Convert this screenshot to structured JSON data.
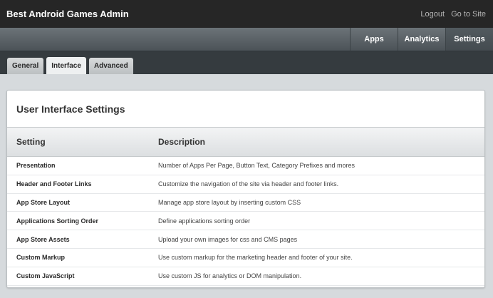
{
  "header": {
    "title": "Best Android Games Admin",
    "links": [
      "Logout",
      "Go to Site"
    ]
  },
  "nav": {
    "items": [
      {
        "label": "Apps",
        "active": false
      },
      {
        "label": "Analytics",
        "active": false
      },
      {
        "label": "Settings",
        "active": true
      }
    ]
  },
  "tabs": [
    {
      "label": "General",
      "active": false
    },
    {
      "label": "Interface",
      "active": true
    },
    {
      "label": "Advanced",
      "active": false
    }
  ],
  "panel": {
    "title": "User Interface Settings",
    "columns": [
      "Setting",
      "Description"
    ],
    "rows": [
      {
        "setting": "Presentation",
        "description": "Number of Apps Per Page, Button Text, Category Prefixes and mores"
      },
      {
        "setting": "Header and Footer Links",
        "description": "Customize the navigation of the site via header and footer links."
      },
      {
        "setting": "App Store Layout",
        "description": "Manage app store layout by inserting custom CSS"
      },
      {
        "setting": "Applications Sorting Order",
        "description": "Define applications sorting order"
      },
      {
        "setting": "App Store Assets",
        "description": "Upload your own images for css and CMS pages"
      },
      {
        "setting": "Custom Markup",
        "description": "Use custom markup for the marketing header and footer of your site."
      },
      {
        "setting": "Custom JavaScript",
        "description": "Use custom JS for analytics or DOM manipulation."
      }
    ]
  },
  "colors": {
    "topbar": "#262626",
    "navbar": "#5a6166",
    "tabbar": "#353b3f",
    "page_background": "#d6dadd"
  }
}
